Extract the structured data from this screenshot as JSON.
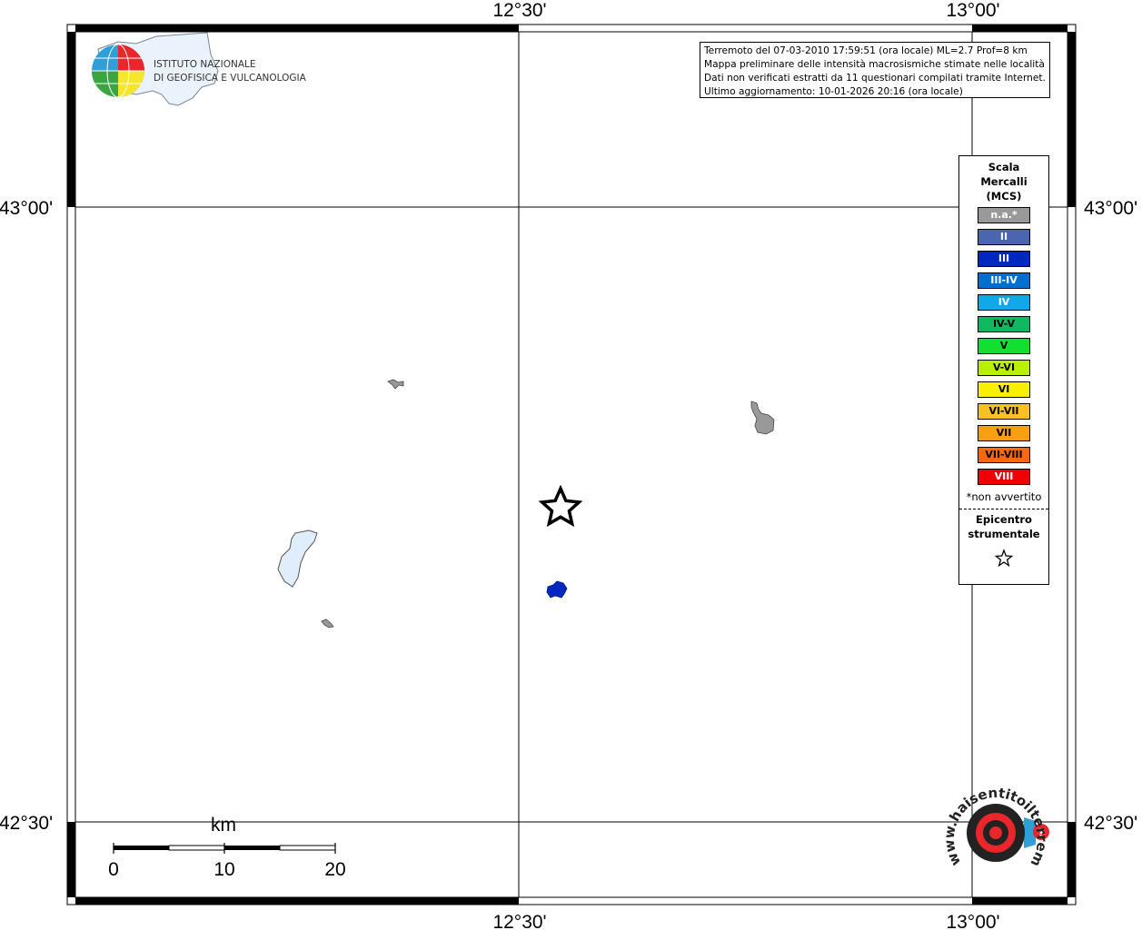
{
  "map": {
    "longitude_labels": [
      "12°30'",
      "13°00'"
    ],
    "latitude_labels": [
      "43°00'",
      "42°30'"
    ]
  },
  "logo": {
    "org_line1": "ISTITUTO NAZIONALE",
    "org_line2": "DI GEOFISICA E VULCANOLOGIA"
  },
  "info": {
    "line1": "Terremoto del 07-03-2010 17:59:51 (ora locale) ML=2.7 Prof=8 km",
    "line2": "Mappa preliminare delle intensità macrosismiche stimate nelle località",
    "line3": "Dati non verificati estratti da 11 questionari compilati tramite Internet.",
    "line4": "Ultimo aggiornamento: 10-01-2026 20:16 (ora locale)"
  },
  "legend": {
    "title_line1": "Scala",
    "title_line2": "Mercalli",
    "title_line3": "(MCS)",
    "items": [
      {
        "label": "n.a.*",
        "color": "#999999"
      },
      {
        "label": "II",
        "color": "#4a66b0"
      },
      {
        "label": "III",
        "color": "#0028c0"
      },
      {
        "label": "III-IV",
        "color": "#0070d0"
      },
      {
        "label": "IV",
        "color": "#10a8e8"
      },
      {
        "label": "IV-V",
        "color": "#10b860"
      },
      {
        "label": "V",
        "color": "#10e030"
      },
      {
        "label": "V-VI",
        "color": "#b8f000"
      },
      {
        "label": "VI",
        "color": "#f8f000"
      },
      {
        "label": "VI-VII",
        "color": "#f8c020"
      },
      {
        "label": "VII",
        "color": "#f8a010"
      },
      {
        "label": "VII-VIII",
        "color": "#f86810"
      },
      {
        "label": "VIII",
        "color": "#f00000"
      }
    ],
    "note": "*non avvertito",
    "epicenter_line1": "Epicentro",
    "epicenter_line2": "strumentale"
  },
  "scale_bar": {
    "unit": "km",
    "tick_labels": [
      "0",
      "10",
      "20"
    ]
  },
  "watermark": {
    "text": "www.haisentitoilterremoto.it"
  }
}
